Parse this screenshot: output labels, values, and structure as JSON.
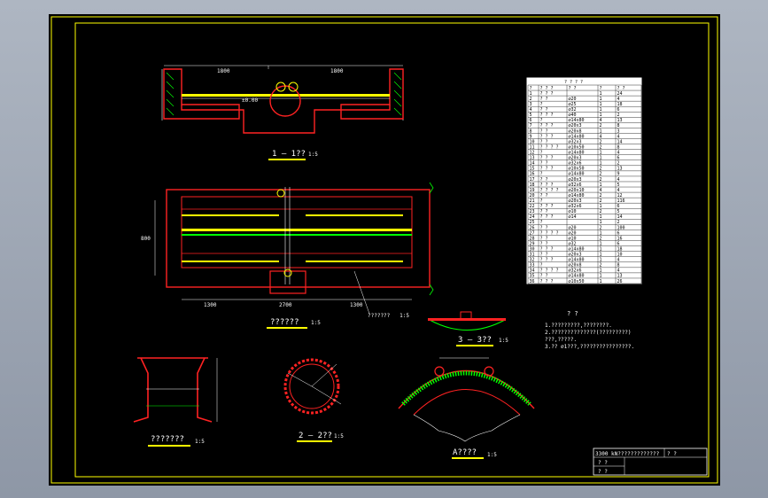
{
  "views": {
    "section_1_1": {
      "title": "1 — 1??",
      "scale": "1:5",
      "dims": [
        "1800",
        "1800"
      ],
      "level": "±0.00"
    },
    "plan": {
      "title": "??????",
      "scale": "1:5",
      "dims_bottom": [
        "1300",
        "2700",
        "1300"
      ],
      "dim_left": "800",
      "note": "???????   1:5"
    },
    "section_3_3": {
      "title": "3 — 3??",
      "scale": "1:5"
    },
    "detail_left": {
      "title": "???????",
      "scale": "1:5"
    },
    "section_2_2": {
      "title": "2 — 2??",
      "scale": "1:5"
    },
    "detail_a": {
      "title": "A????",
      "scale": "1:5"
    }
  },
  "notes": {
    "title": "? ?",
    "lines": [
      "1.?????????,????????.",
      "2.??????????????(?????????)",
      "  ???,?????.",
      "3.?? ⌀1???,????????????????."
    ]
  },
  "bom": {
    "title": "? ? ? ?",
    "headers": [
      "?",
      "? ? ?",
      "? ?",
      "?",
      "? ?"
    ],
    "rows": [
      [
        "1",
        "? ? ?",
        "",
        "1",
        "24"
      ],
      [
        "2",
        "? ?",
        "⌀20",
        "1",
        "4"
      ],
      [
        "3",
        "?",
        "⌀25",
        "1",
        "18"
      ],
      [
        "4",
        "? ?",
        "⌀32",
        "1",
        "6"
      ],
      [
        "5",
        "? ? ?",
        "⌀40",
        "1",
        "2"
      ],
      [
        "6",
        "?",
        "⌀14x80",
        "4",
        "13"
      ],
      [
        "7",
        "? ? ?",
        "⌀20x3",
        "2",
        "8"
      ],
      [
        "8",
        "? ?",
        "⌀20x8",
        "1",
        "3"
      ],
      [
        "9",
        "? ? ?",
        "⌀14x80",
        "4",
        "4"
      ],
      [
        "10",
        "? ?",
        "⌀32x3",
        "2",
        "14"
      ],
      [
        "11",
        "? ? ? ?",
        "⌀10x50",
        "2",
        "8"
      ],
      [
        "12",
        "?",
        "⌀14x80",
        "1",
        "4"
      ],
      [
        "13",
        "? ? ?",
        "⌀20x3",
        "1",
        "6"
      ],
      [
        "14",
        "? ?",
        "⌀32x6",
        "1",
        "2"
      ],
      [
        "15",
        "? ? ?",
        "⌀10x50",
        "2",
        "13"
      ],
      [
        "16",
        "?",
        "⌀14x80",
        "2",
        "9"
      ],
      [
        "17",
        "? ?",
        "⌀20x3",
        "2",
        "4"
      ],
      [
        "18",
        "? ? ?",
        "⌀32x6",
        "1",
        "5"
      ],
      [
        "19",
        "? ? ? ?",
        "⌀20x10",
        "4",
        "4"
      ],
      [
        "20",
        "? ?",
        "⌀14x80",
        "2",
        "12"
      ],
      [
        "21",
        "?",
        "⌀20x3",
        "2",
        "116"
      ],
      [
        "22",
        "? ? ?",
        "⌀32x6",
        "1",
        "6"
      ],
      [
        "23",
        "? ?",
        "⌀10",
        "2",
        "5"
      ],
      [
        "24",
        "? ? ?",
        "⌀14",
        "1",
        "14"
      ],
      [
        "25",
        "?",
        "",
        "1",
        "2"
      ],
      [
        "26",
        "? ?",
        "⌀20",
        "2",
        "100"
      ],
      [
        "27",
        "? ? ? ?",
        "⌀20",
        "1",
        "6"
      ],
      [
        "28",
        "? ?",
        "⌀10",
        "2",
        "16"
      ],
      [
        "29",
        "? ?",
        "⌀32",
        "1",
        "6"
      ],
      [
        "30",
        "? ? ?",
        "⌀14x80",
        "1",
        "18"
      ],
      [
        "31",
        "? ?",
        "⌀20x3",
        "1",
        "10"
      ],
      [
        "32",
        "? ? ?",
        "⌀14x80",
        "1",
        "4"
      ],
      [
        "33",
        "?",
        "⌀20x8",
        "2",
        "8"
      ],
      [
        "34",
        "? ? ? ?",
        "⌀32x6",
        "1",
        "4"
      ],
      [
        "35",
        "? ?",
        "⌀14x80",
        "1",
        "13"
      ],
      [
        "36",
        "? ? ?",
        "⌀10x50",
        "1",
        "26"
      ]
    ]
  },
  "title_block": {
    "main": "3300 kN?????????????",
    "cell_a": "? ?",
    "cell_b": "? ?",
    "cell_c": "? ?"
  },
  "colors": {
    "paper": "#000000",
    "border": "#ffff00",
    "outline": "#ff2222",
    "dim": "#ffffff",
    "hatch": "#00ff00"
  }
}
